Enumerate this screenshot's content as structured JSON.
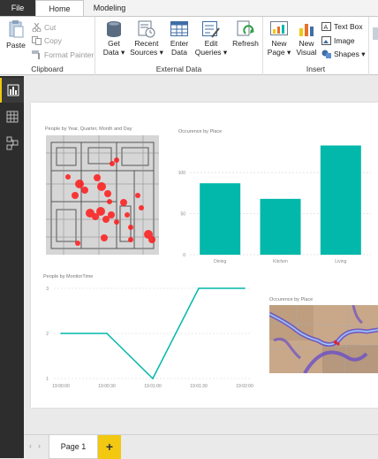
{
  "tabs": {
    "file": "File",
    "home": "Home",
    "modeling": "Modeling"
  },
  "clipboard": {
    "paste": "Paste",
    "cut": "Cut",
    "copy": "Copy",
    "format_painter": "Format Painter",
    "label": "Clipboard"
  },
  "external_data": {
    "get_data": [
      "Get",
      "Data ▾"
    ],
    "recent_sources": [
      "Recent",
      "Sources ▾"
    ],
    "enter_data": [
      "Enter",
      "Data"
    ],
    "edit_queries": [
      "Edit",
      "Queries ▾"
    ],
    "refresh": "Refresh",
    "label": "External Data"
  },
  "insert": {
    "new_page": [
      "New",
      "Page ▾"
    ],
    "new_visual": [
      "New",
      "Visual"
    ],
    "text_box": "Text Box",
    "image": "Image",
    "shapes": "Shapes ▾",
    "label": "Insert"
  },
  "visuals": {
    "map1_title": "People by Year, Quarter, Month and Day",
    "bar_title": "Occurence by Place",
    "line_title": "People by MonitorTime",
    "map2_title": "Occurence by Place"
  },
  "colors": {
    "teal": "#01b8aa",
    "accent": "#f2c811",
    "dark": "#2d2d2d"
  },
  "chart_data": [
    {
      "type": "bar",
      "title": "Occurence by Place",
      "categories": [
        "Dining",
        "Kitchen",
        "Living"
      ],
      "values": [
        87,
        68,
        133
      ],
      "yticks": [
        0,
        50,
        100
      ],
      "ylim": [
        0,
        140
      ],
      "grid": true
    },
    {
      "type": "line",
      "title": "People by MonitorTime",
      "x": [
        "19:00:00",
        "19:00:30",
        "19:01:00",
        "19:01:30",
        "19:02:00"
      ],
      "points": [
        {
          "x": 0,
          "y": 2
        },
        {
          "x": 1,
          "y": 2
        },
        {
          "x": 2,
          "y": 1
        },
        {
          "x": 3,
          "y": 3
        },
        {
          "x": 4,
          "y": 3
        }
      ],
      "yticks": [
        1,
        2,
        3
      ],
      "ylim": [
        1,
        3
      ],
      "grid": true
    }
  ],
  "page_tab": "Page 1",
  "add_page": "+"
}
